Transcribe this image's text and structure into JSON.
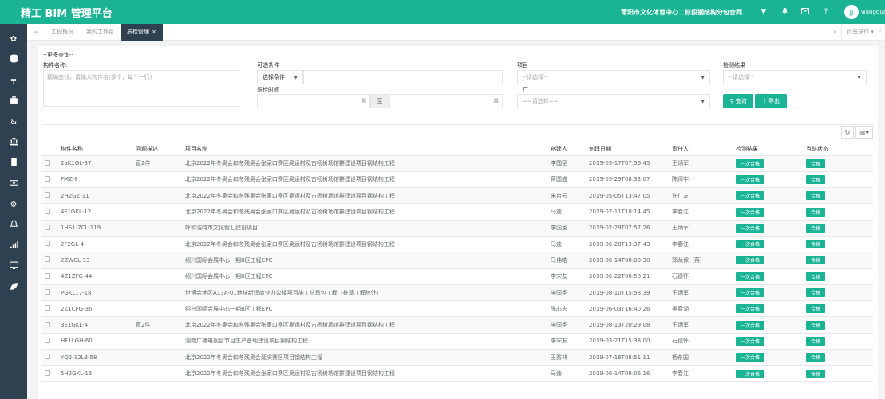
{
  "app": {
    "title": "精工 BIM 管理平台",
    "project_name": "莆阳市文化体育中心二标段钢结构分包合同",
    "username": "wangquan"
  },
  "tabs": [
    {
      "label": "工程概况",
      "active": false
    },
    {
      "label": "我的工作台",
      "active": false
    },
    {
      "label": "质检管理",
      "active": true
    }
  ],
  "tab_actions": {
    "more_label": "页签操作"
  },
  "search": {
    "heading": "--更多查询--",
    "component_label": "构件名称:",
    "component_placeholder": "精确查找，请输入构件名(多个，每个一行)",
    "filter_label": "可选条件",
    "filter_select": "选择条件",
    "date_label": "质检时间",
    "date_sep": "至",
    "project_label": "项目",
    "project_placeholder": "--请选择--",
    "factory_label": "工厂",
    "factory_placeholder": "==请选择==",
    "result_label": "检测结果",
    "result_placeholder": "--请选择--",
    "query_button": "查询",
    "export_button": "导出"
  },
  "table": {
    "headers": [
      "构件名称",
      "问题描述",
      "项目名称",
      "创建人",
      "创建日期",
      "责任人",
      "检测结果",
      "当前状态"
    ],
    "rows": [
      {
        "name": "2aK1GL-37",
        "issue": "直2件",
        "project": "北京2022年冬奥会和冬残奥会张家口赛区奥运村及古杨树场馆群建设项目钢结构工程",
        "creator": "李国圣",
        "date": "2019-05-17T07:56:45",
        "owner": "王炳军",
        "result": "一次合格",
        "status": "合格"
      },
      {
        "name": "FMZ-8",
        "issue": "",
        "project": "北京2022年冬奥会和冬残奥会张家口赛区奥运村及古杨树场馆群建设项目钢结构工程",
        "creator": "蒋国盛",
        "date": "2019-05-29T08:33:07",
        "owner": "陈师宇",
        "result": "一次合格",
        "status": "合格"
      },
      {
        "name": "2H2GZ-11",
        "issue": "",
        "project": "北京2022年冬奥会和冬残奥会张家口赛区奥运村及古杨树场馆群建设项目钢结构工程",
        "creator": "朱台云",
        "date": "2019-05-05T13:47:05",
        "owner": "许仁友",
        "result": "一次合格",
        "status": "合格"
      },
      {
        "name": "4F1GKL-12",
        "issue": "",
        "project": "北京2022年冬奥会和冬残奥会张家口赛区奥运村及古杨树场馆群建设项目钢结构工程",
        "creator": "马迪",
        "date": "2019-07-11T10:14:45",
        "owner": "李春江",
        "result": "一次合格",
        "status": "合格"
      },
      {
        "name": "1HS1-7CL-119",
        "issue": "",
        "project": "呼和浩特市文化智汇建设项目",
        "creator": "李国圣",
        "date": "2019-07-29T07:57:26",
        "owner": "王炳军",
        "result": "一次合格",
        "status": "合格"
      },
      {
        "name": "2F2GL-4",
        "issue": "",
        "project": "北京2022年冬奥会和冬残奥会张家口赛区奥运村及古杨树场馆群建设项目钢结构工程",
        "creator": "马迪",
        "date": "2019-06-20T13:37:43",
        "owner": "李春江",
        "result": "一次合格",
        "status": "合格"
      },
      {
        "name": "2ZWCL-33",
        "issue": "",
        "project": "绍兴国际会展中心一期B区工程EPC",
        "creator": "马伟皓",
        "date": "2019-06-14T08:00:30",
        "owner": "郭龙保（蒋）",
        "result": "一次合格",
        "status": "合格"
      },
      {
        "name": "4Z1ZFG-44",
        "issue": "",
        "project": "绍兴国际会展中心一期B区工程EPC",
        "creator": "李宋友",
        "date": "2019-06-22T08:58:21",
        "owner": "石德怀",
        "result": "一次合格",
        "status": "合格"
      },
      {
        "name": "PGKL17-18",
        "issue": "",
        "project": "世博会地区A13A-01地块新建商业办公楼项目施工总承包工程（桩基工程除外）",
        "creator": "李国圣",
        "date": "2019-08-10T15:58:39",
        "owner": "王炳军",
        "result": "一次合格",
        "status": "合格"
      },
      {
        "name": "2Z1CFG-36",
        "issue": "",
        "project": "绍兴国际会展中心一期B区工程EPC",
        "creator": "陈心志",
        "date": "2019-06-03T16:40:26",
        "owner": "吴春湖",
        "result": "一次合格",
        "status": "合格"
      },
      {
        "name": "3E1GKL-4",
        "issue": "直2件",
        "project": "北京2022年冬奥会和冬残奥会张家口赛区奥运村及古杨树场馆群建设项目钢结构工程",
        "creator": "李国圣",
        "date": "2019-08-13T20:29:08",
        "owner": "王炳军",
        "result": "一次合格",
        "status": "合格"
      },
      {
        "name": "HF1LGH-60",
        "issue": "",
        "project": "湖南广播电视台节目生产基地建设项目钢结构工程",
        "creator": "李宋友",
        "date": "2019-03-21T15:38:00",
        "owner": "石德怀",
        "result": "一次合格",
        "status": "合格"
      },
      {
        "name": "YQ2-12L3-58",
        "issue": "",
        "project": "北京2022年冬奥会和冬残奥会延庆赛区项目钢结构工程",
        "creator": "王秀林",
        "date": "2019-07-16T08:51:11",
        "owner": "杨东国",
        "result": "一次合格",
        "status": "合格"
      },
      {
        "name": "5H2GKL-15",
        "issue": "",
        "project": "北京2022年冬奥会和冬残奥会张家口赛区奥运村及古杨树场馆群建设项目钢结构工程",
        "creator": "马迪",
        "date": "2019-06-14T09:06:16",
        "owner": "李春江",
        "result": "一次合格",
        "status": "合格"
      }
    ]
  },
  "colors": {
    "brand": "#1ab394",
    "sidebar": "#2f4050"
  }
}
